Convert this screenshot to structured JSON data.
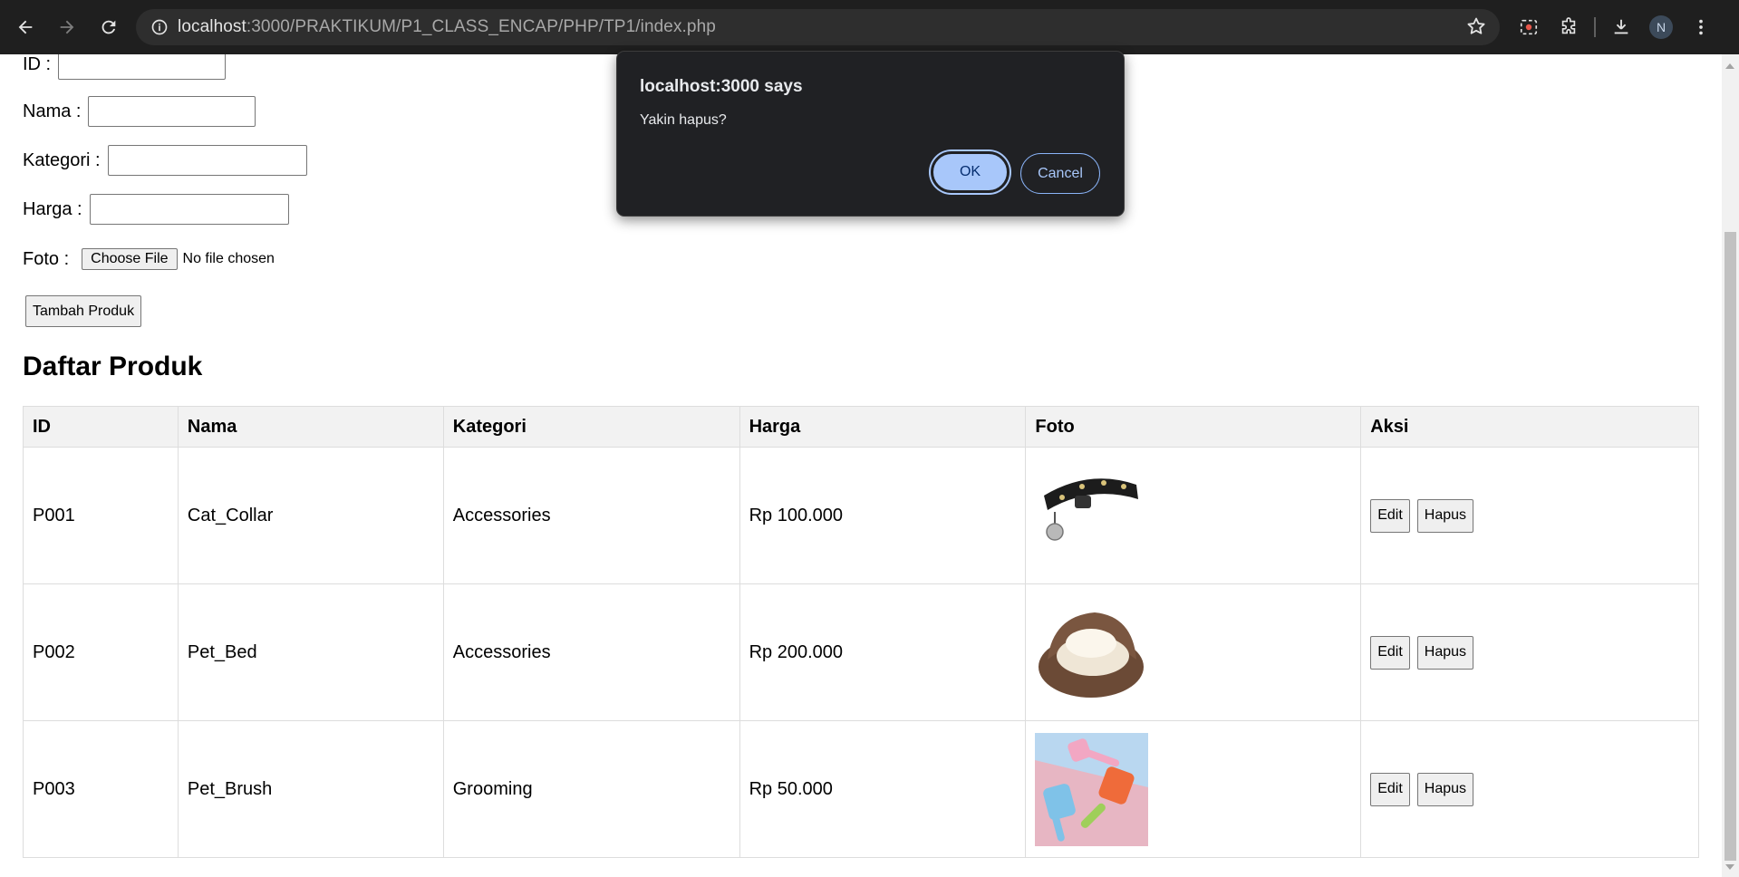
{
  "browser": {
    "url_host": "localhost",
    "url_path": ":3000/PRAKTIKUM/P1_CLASS_ENCAP/PHP/TP1/index.php",
    "profile_initial": "N"
  },
  "form": {
    "id_label": "ID :",
    "nama_label": "Nama :",
    "kategori_label": "Kategori :",
    "harga_label": "Harga :",
    "foto_label": "Foto :",
    "choose_file": "Choose File",
    "no_file": "No file chosen",
    "submit": "Tambah Produk"
  },
  "list_title": "Daftar Produk",
  "table": {
    "headers": [
      "ID",
      "Nama",
      "Kategori",
      "Harga",
      "Foto",
      "Aksi"
    ],
    "rows": [
      {
        "id": "P001",
        "nama": "Cat_Collar",
        "kategori": "Accessories",
        "harga": "Rp 100.000",
        "foto": "cat-collar",
        "edit": "Edit",
        "hapus": "Hapus"
      },
      {
        "id": "P002",
        "nama": "Pet_Bed",
        "kategori": "Accessories",
        "harga": "Rp 200.000",
        "foto": "pet-bed",
        "edit": "Edit",
        "hapus": "Hapus"
      },
      {
        "id": "P003",
        "nama": "Pet_Brush",
        "kategori": "Grooming",
        "harga": "Rp 50.000",
        "foto": "pet-brush",
        "edit": "Edit",
        "hapus": "Hapus"
      }
    ]
  },
  "dialog": {
    "title": "localhost:3000 says",
    "message": "Yakin hapus?",
    "ok": "OK",
    "cancel": "Cancel"
  },
  "colors": {
    "chrome_bg": "#1f1f1f",
    "dialog_bg": "#202124",
    "accent": "#a8c7fa"
  }
}
